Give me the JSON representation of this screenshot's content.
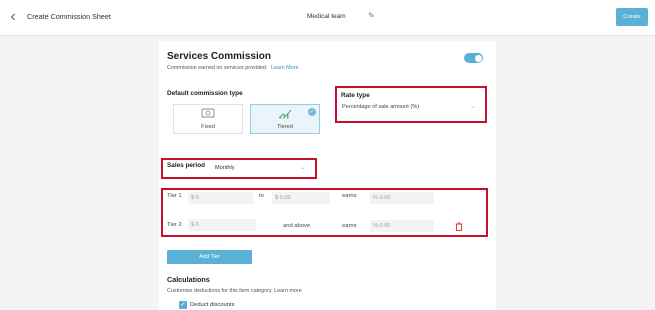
{
  "header": {
    "back_icon": "chevron-left-icon",
    "title": "Create Commission Sheet",
    "team": "Medical team",
    "edit_icon": "pencil-icon",
    "create_label": "Create"
  },
  "services": {
    "title": "Services Commission",
    "subtitle": "Commission earned on services provided.",
    "learn_more": "Learn More",
    "enabled": true
  },
  "commission_type": {
    "label": "Default commission type",
    "options": [
      {
        "label": "Fixed",
        "icon": "cash-icon",
        "selected": false
      },
      {
        "label": "Tiered",
        "icon": "chart-icon",
        "selected": true
      }
    ]
  },
  "rate_type": {
    "label": "Rate type",
    "value": "Percentage of sale amount (%)"
  },
  "sales_period": {
    "label": "Sales period",
    "value": "Monthly"
  },
  "tiers": [
    {
      "label": "Tier 1",
      "from": "$ 0",
      "to_word": "to",
      "to": "$ 0.00",
      "earns": "earns",
      "rate": "% 0.00"
    },
    {
      "label": "Tier 2",
      "from": "$ 0",
      "to_word": "and above",
      "earns": "earns",
      "rate": "% 0.00"
    }
  ],
  "add_tier_label": "Add Tier",
  "calculations": {
    "title": "Calculations",
    "subtitle": "Customise deductions for this item category. Learn more",
    "deduct_label": "Deduct discounts",
    "deduct_checked": true
  },
  "colors": {
    "accent": "#5bb0d6",
    "highlight": "#c8102e",
    "delete": "#d0312d"
  }
}
